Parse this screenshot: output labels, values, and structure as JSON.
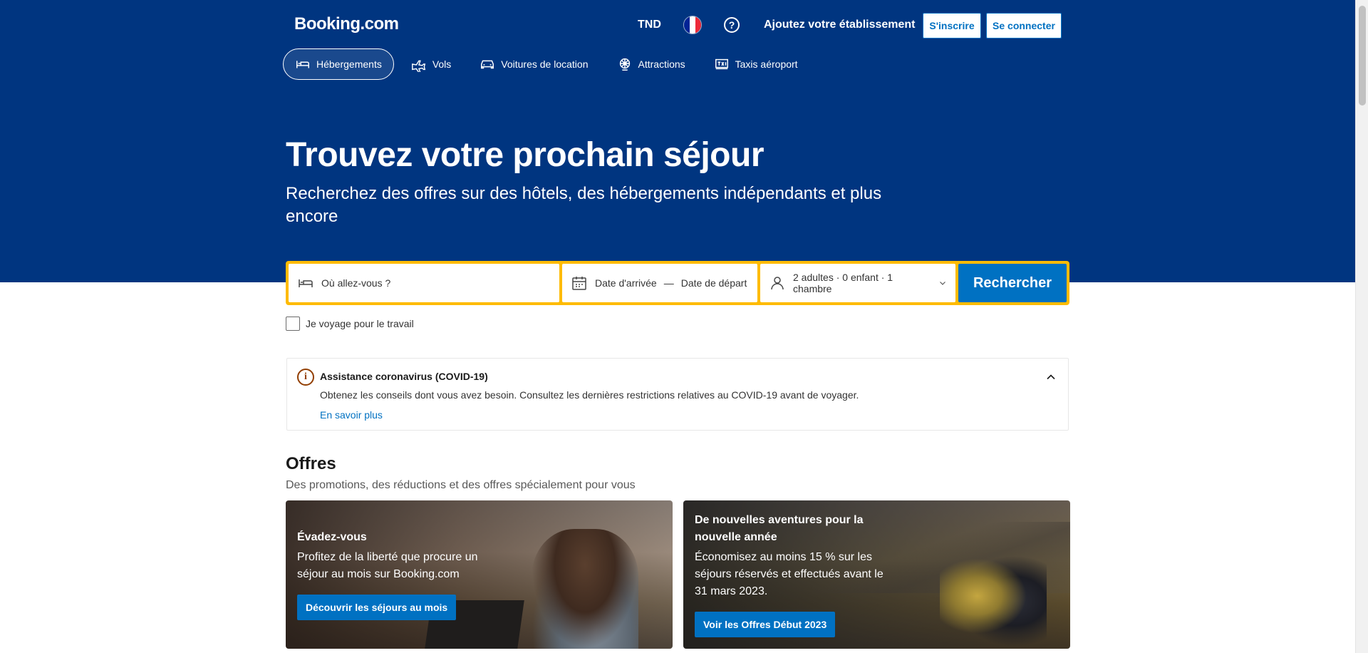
{
  "header": {
    "logo": "Booking.com",
    "currency": "TND",
    "language_flag": [
      "#002395",
      "#ffffff",
      "#ed2939"
    ],
    "help_icon": "question-circle-icon",
    "add_property": "Ajoutez votre établissement",
    "register": "S'inscrire",
    "login": "Se connecter"
  },
  "nav": {
    "items": [
      {
        "label": "Hébergements",
        "icon": "bed-icon",
        "active": true
      },
      {
        "label": "Vols",
        "icon": "plane-icon"
      },
      {
        "label": "Voitures de location",
        "icon": "car-icon"
      },
      {
        "label": "Attractions",
        "icon": "attractions-icon"
      },
      {
        "label": "Taxis aéroport",
        "icon": "taxi-icon"
      }
    ]
  },
  "hero": {
    "title": "Trouvez votre prochain séjour",
    "subtitle": "Recherchez des offres sur des hôtels, des hébergements indépendants et plus encore"
  },
  "search": {
    "destination_placeholder": "Où allez-vous ?",
    "checkin": "Date d'arrivée",
    "separator": "—",
    "checkout": "Date de départ",
    "guests": "2 adultes · 0 enfant · 1 chambre",
    "button": "Rechercher",
    "work_trip": "Je voyage pour le travail"
  },
  "covid": {
    "title": "Assistance coronavirus (COVID-19)",
    "text": "Obtenez les conseils dont vous avez besoin. Consultez les dernières restrictions relatives au COVID-19 avant de voyager.",
    "link": "En savoir plus"
  },
  "offers": {
    "title": "Offres",
    "subtitle": "Des promotions, des réductions et des offres spécialement pour vous",
    "cards": [
      {
        "title": "Évadez-vous",
        "text": "Profitez de la liberté que procure un séjour au mois sur Booking.com",
        "button": "Découvrir les séjours au mois"
      },
      {
        "title": "De nouvelles aventures pour la nouvelle année",
        "text": "Économisez au moins 15 % sur les séjours réservés et effectués avant le 31 mars 2023.",
        "button": "Voir les Offres Début 2023"
      }
    ]
  }
}
